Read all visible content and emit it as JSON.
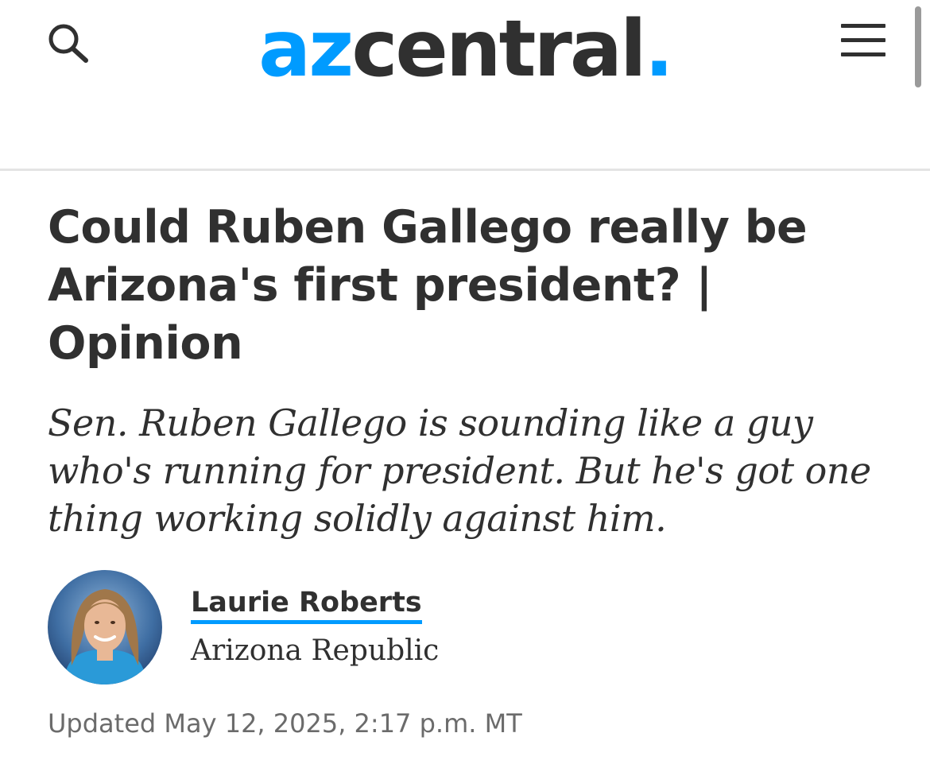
{
  "header": {
    "logo": {
      "part1": "az",
      "part2": "central",
      "dot": "."
    },
    "search_icon": "search-icon",
    "menu_icon": "hamburger-menu-icon"
  },
  "article": {
    "headline": "Could Ruben Gallego really be Arizona's first president? | Opinion",
    "dek": "Sen. Ruben Gallego is sounding like a guy who's running for president. But he's got one thing working solidly against him.",
    "author": {
      "name": "Laurie Roberts",
      "publication": "Arizona Republic"
    },
    "timestamp": "Updated May 12, 2025, 2:17 p.m. MT"
  },
  "colors": {
    "accent": "#009bff",
    "text": "#303030",
    "muted": "#6b6b6b",
    "divider": "#e4e4e4"
  }
}
